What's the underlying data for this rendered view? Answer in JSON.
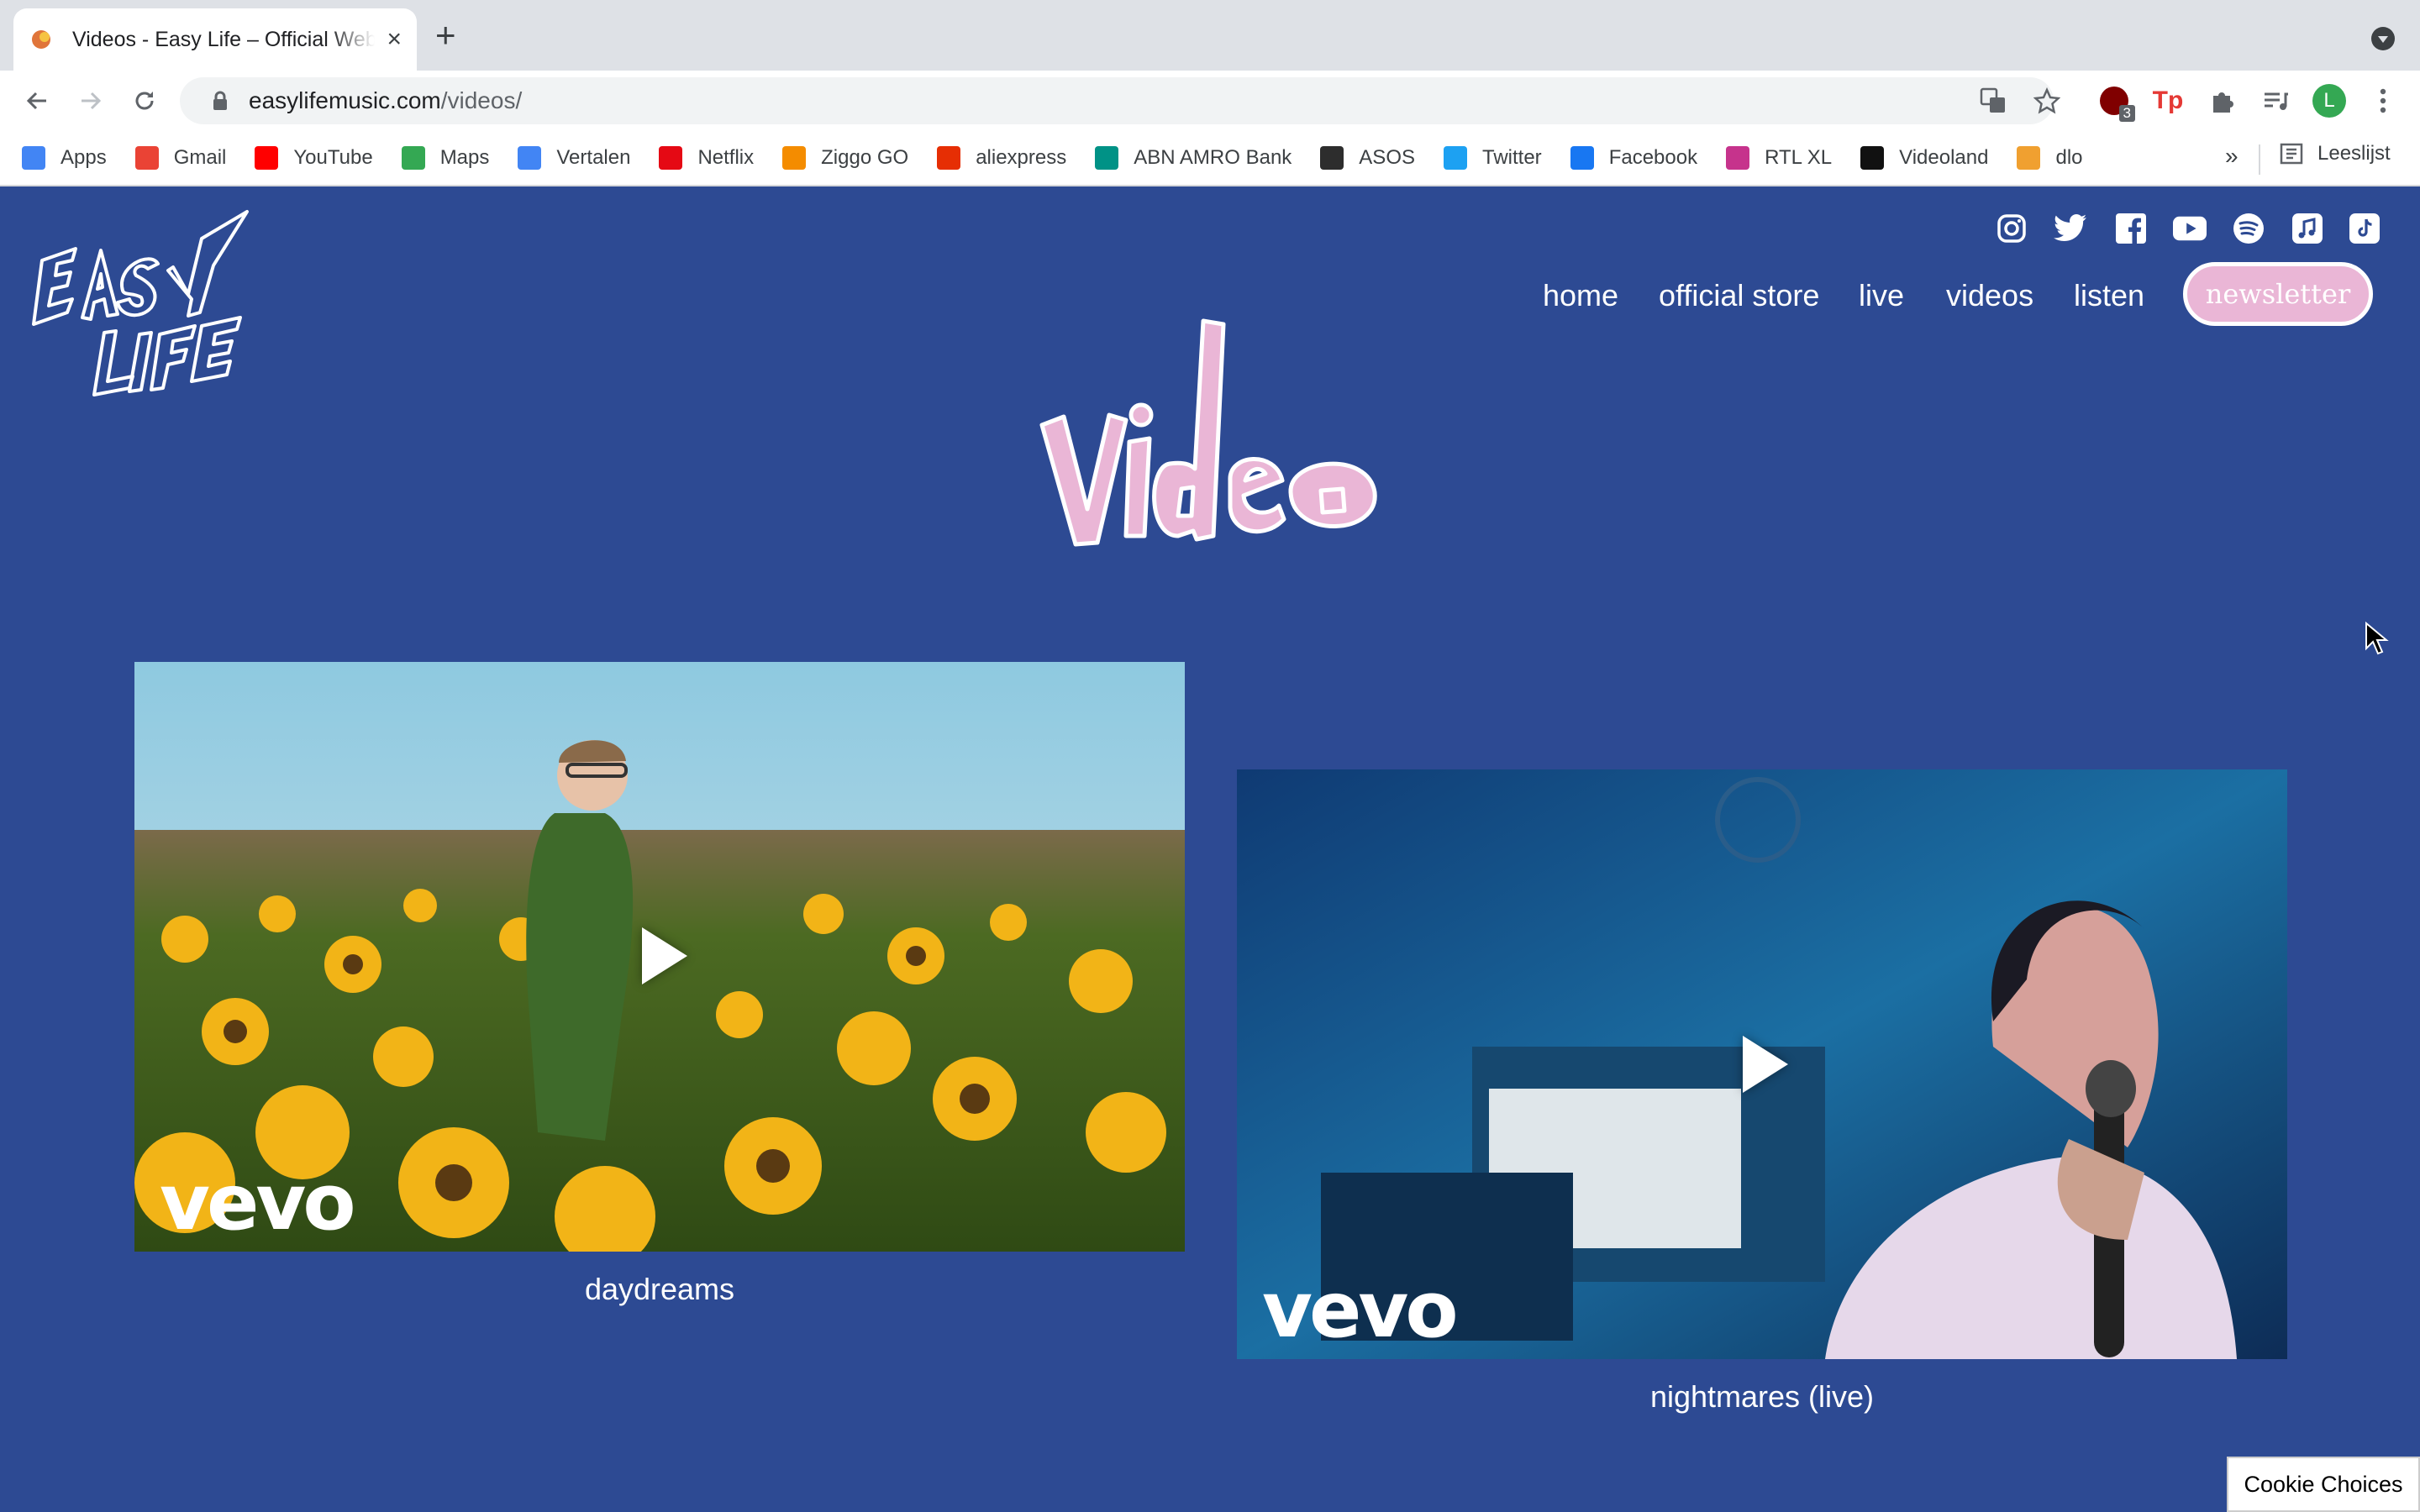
{
  "browser": {
    "tab_title": "Videos - Easy Life – Official Website",
    "new_tab": "+",
    "close": "×",
    "url_domain": "easylifemusic.com",
    "url_path": "/videos/",
    "extension_badge": "3",
    "profile_initial": "L"
  },
  "bookmarks": [
    {
      "label": "Apps",
      "icon": "apps-grid-icon",
      "color": "#4285f4"
    },
    {
      "label": "Gmail",
      "icon": "gmail-icon",
      "color": "#ea4335"
    },
    {
      "label": "YouTube",
      "icon": "youtube-icon",
      "color": "#ff0000"
    },
    {
      "label": "Maps",
      "icon": "maps-icon",
      "color": "#34a853"
    },
    {
      "label": "Vertalen",
      "icon": "translate-icon",
      "color": "#4285f4"
    },
    {
      "label": "Netflix",
      "icon": "netflix-icon",
      "color": "#e50914"
    },
    {
      "label": "Ziggo GO",
      "icon": "ziggo-icon",
      "color": "#f48c00"
    },
    {
      "label": "aliexpress",
      "icon": "aliexpress-icon",
      "color": "#e62e04"
    },
    {
      "label": "ABN AMRO Bank",
      "icon": "abnamro-icon",
      "color": "#009286"
    },
    {
      "label": "ASOS",
      "icon": "asos-icon",
      "color": "#2d2d2d"
    },
    {
      "label": "Twitter",
      "icon": "twitter-icon",
      "color": "#1da1f2"
    },
    {
      "label": "Facebook",
      "icon": "facebook-icon",
      "color": "#1877f2"
    },
    {
      "label": "RTL XL",
      "icon": "rtlxl-icon",
      "color": "#c6338c"
    },
    {
      "label": "Videoland",
      "icon": "videoland-icon",
      "color": "#111111"
    },
    {
      "label": "dlo",
      "icon": "dlo-icon",
      "color": "#f0a030"
    }
  ],
  "bookmarks_more": "»",
  "reading_list": "Leeslijst",
  "site": {
    "nav": [
      "home",
      "official store",
      "live",
      "videos",
      "listen"
    ],
    "newsletter": "newsletter",
    "social_icons": [
      "instagram-icon",
      "twitter-icon",
      "facebook-icon",
      "youtube-icon",
      "spotify-icon",
      "apple-music-icon",
      "tiktok-icon"
    ],
    "videos": [
      {
        "title": "daydreams",
        "watermark": "vevo"
      },
      {
        "title": "nightmares (live)",
        "watermark": "vevo"
      }
    ],
    "cookie_button": "Cookie Choices"
  },
  "colors": {
    "page_bg": "#2d4a93",
    "accent_pink": "#eab6d6"
  }
}
